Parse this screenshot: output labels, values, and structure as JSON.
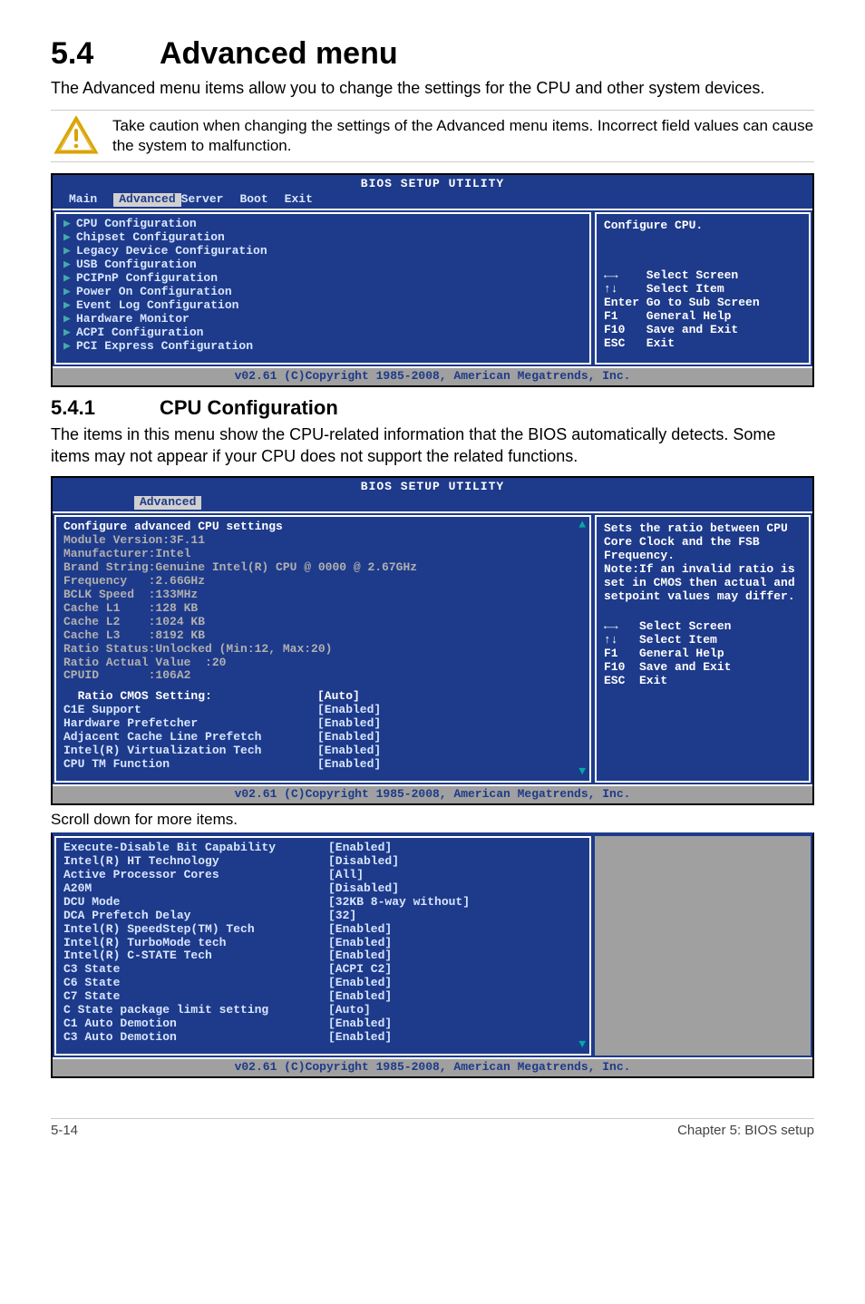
{
  "h1_num": "5.4",
  "h1_txt": "Advanced menu",
  "intro": "The Advanced menu items allow you to change the settings for the CPU and other system devices.",
  "warn": "Take caution when changing the settings of the Advanced menu items. Incorrect field values can cause the system to malfunction.",
  "bios_title": "BIOS SETUP UTILITY",
  "tabs": {
    "main": "Main",
    "advanced": "Advanced",
    "server": "Server",
    "boot": "Boot",
    "exit": "Exit"
  },
  "adv_menu": [
    "CPU Configuration",
    "Chipset Configuration",
    "Legacy Device Configuration",
    "USB Configuration",
    "PCIPnP Configuration",
    "Power On Configuration",
    "Event Log Configuration",
    "Hardware Monitor",
    "ACPI Configuration",
    "PCI Express Configuration"
  ],
  "adv_help": "Configure CPU.",
  "nav": {
    "l1": "←→    Select Screen",
    "l2": "↑↓    Select Item",
    "l3": "Enter Go to Sub Screen",
    "l4": "F1    General Help",
    "l5": "F10   Save and Exit",
    "l6": "ESC   Exit"
  },
  "copyright": "v02.61 (C)Copyright 1985-2008, American Megatrends, Inc.",
  "h2_num": "5.4.1",
  "h2_txt": "CPU Configuration",
  "h2_para": "The items in this menu show the CPU-related information that the BIOS automatically detects. Some items may not appear if your CPU does not support the related functions.",
  "cpu_head": "Configure advanced CPU settings",
  "cpu_mod": "Module Version:3F.11",
  "cpu_info": [
    "Manufacturer:Intel",
    "Brand String:Genuine Intel(R) CPU @ 0000 @ 2.67GHz",
    "Frequency   :2.66GHz",
    "BCLK Speed  :133MHz",
    "Cache L1    :128 KB",
    "Cache L2    :1024 KB",
    "Cache L3    :8192 KB",
    "Ratio Status:Unlocked (Min:12, Max:20)",
    "Ratio Actual Value  :20",
    "CPUID       :106A2"
  ],
  "cpu_opts": [
    {
      "n": "  Ratio CMOS Setting:",
      "v": "[Auto]",
      "w": true
    },
    {
      "n": "C1E Support",
      "v": "[Enabled]"
    },
    {
      "n": "Hardware Prefetcher",
      "v": "[Enabled]"
    },
    {
      "n": "Adjacent Cache Line Prefetch",
      "v": "[Enabled]"
    },
    {
      "n": "Intel(R) Virtualization Tech",
      "v": "[Enabled]"
    },
    {
      "n": "CPU TM Function",
      "v": "[Enabled]"
    }
  ],
  "cpu_help": "Sets the ratio between CPU Core Clock and the FSB Frequency.\nNote:If an invalid ratio is set in CMOS then actual and setpoint values may differ.",
  "nav2": {
    "l1": "←→   Select Screen",
    "l2": "↑↓   Select Item",
    "l3": "F1   General Help",
    "l4": "F10  Save and Exit",
    "l5": "ESC  Exit"
  },
  "scroll_note": "Scroll down for more items.",
  "more_opts": [
    {
      "n": "Execute-Disable Bit Capability",
      "v": "[Enabled]"
    },
    {
      "n": "Intel(R) HT Technology",
      "v": "[Disabled]"
    },
    {
      "n": "Active Processor Cores",
      "v": "[All]"
    },
    {
      "n": "A20M",
      "v": "[Disabled]"
    },
    {
      "n": "DCU Mode",
      "v": "[32KB 8-way without]"
    },
    {
      "n": "DCA Prefetch Delay",
      "v": "[32]"
    },
    {
      "n": "Intel(R) SpeedStep(TM) Tech",
      "v": "[Enabled]"
    },
    {
      "n": "Intel(R) TurboMode tech",
      "v": "[Enabled]"
    },
    {
      "n": "Intel(R) C-STATE Tech",
      "v": "[Enabled]"
    },
    {
      "n": "C3 State",
      "v": "[ACPI C2]"
    },
    {
      "n": "C6 State",
      "v": "[Enabled]"
    },
    {
      "n": "C7 State",
      "v": "[Enabled]"
    },
    {
      "n": "C State package limit setting",
      "v": "[Auto]"
    },
    {
      "n": "C1 Auto Demotion",
      "v": "[Enabled]"
    },
    {
      "n": "C3 Auto Demotion",
      "v": "[Enabled]"
    }
  ],
  "footer_left": "5-14",
  "footer_right": "Chapter 5: BIOS setup",
  "chart_data": null
}
